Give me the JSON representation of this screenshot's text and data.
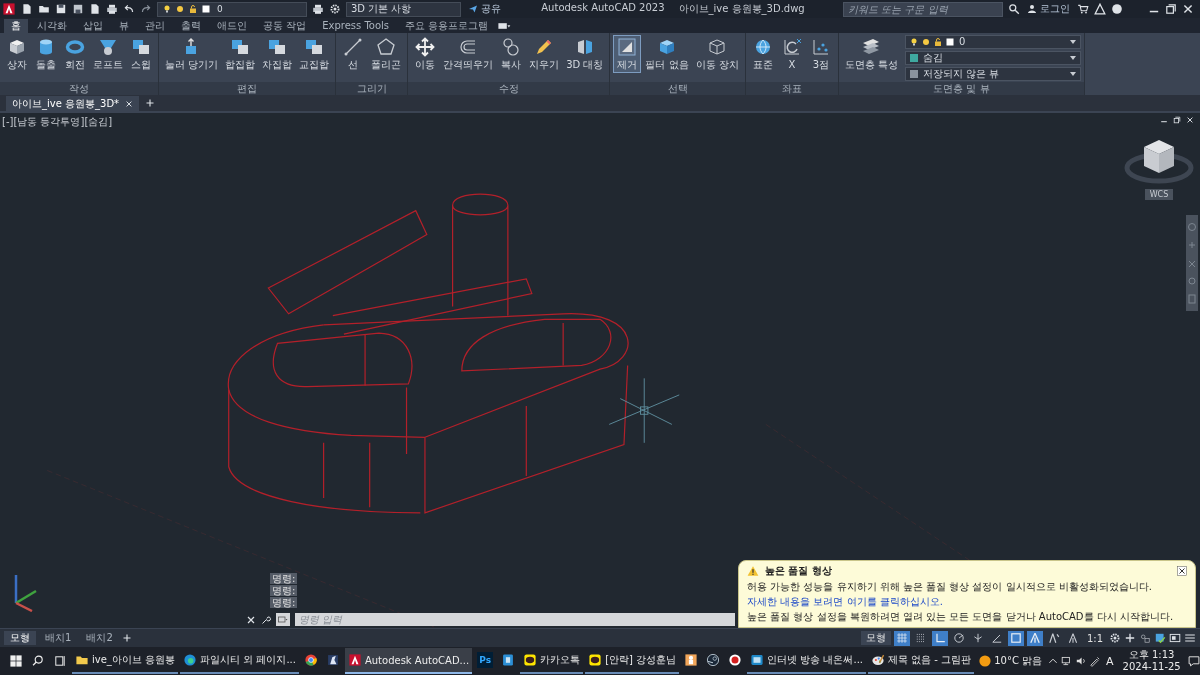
{
  "title_bar": {
    "layer": "0",
    "workspace": "3D 기본 사항",
    "share": "공유",
    "app_name": "Autodesk AutoCAD 2023",
    "file_name": "아이브_ive 응원봉_3D.dwg",
    "search": {
      "placeholder": "키워드 또는 구문 입력"
    },
    "login": "로그인"
  },
  "ribbon_tabs": [
    {
      "label": "홈",
      "selected": true
    },
    {
      "label": "시각화",
      "selected": false
    },
    {
      "label": "삽입",
      "selected": false
    },
    {
      "label": "뷰",
      "selected": false
    },
    {
      "label": "관리",
      "selected": false
    },
    {
      "label": "출력",
      "selected": false
    },
    {
      "label": "애드인",
      "selected": false
    },
    {
      "label": "공동 작업",
      "selected": false
    },
    {
      "label": "Express Tools",
      "selected": false
    },
    {
      "label": "주요 응용프로그램",
      "selected": false
    }
  ],
  "ribbon_panels": [
    {
      "title": "작성",
      "tools": [
        {
          "label": "상자",
          "selected": false
        },
        {
          "label": "돌출",
          "selected": false
        },
        {
          "label": "회전",
          "selected": false
        },
        {
          "label": "로프트",
          "selected": false
        },
        {
          "label": "스윕",
          "selected": false
        }
      ]
    },
    {
      "title": "편집",
      "tools": [
        {
          "label": "눌러 당기기",
          "selected": false
        },
        {
          "label": "합집합",
          "selected": false
        },
        {
          "label": "차집합",
          "selected": false
        },
        {
          "label": "교집합",
          "selected": false
        }
      ]
    },
    {
      "title": "그리기",
      "tools": [
        {
          "label": "선",
          "selected": false
        },
        {
          "label": "폴리곤",
          "selected": false
        }
      ]
    },
    {
      "title": "수정",
      "tools": [
        {
          "label": "이동",
          "selected": false
        },
        {
          "label": "간격띄우기",
          "selected": false
        },
        {
          "label": "복사",
          "selected": false
        },
        {
          "label": "지우기",
          "selected": false
        },
        {
          "label": "3D 대칭",
          "selected": false
        }
      ]
    },
    {
      "title": "선택",
      "tools": [
        {
          "label": "제거",
          "selected": true
        },
        {
          "label": "필터 없음",
          "selected": false
        },
        {
          "label": "이동 장치",
          "selected": false
        }
      ]
    },
    {
      "title": "좌표",
      "tools": [
        {
          "label": "표준",
          "selected": false
        },
        {
          "label": "X",
          "selected": false
        },
        {
          "label": "3점",
          "selected": false
        }
      ]
    },
    {
      "title": "도면층 및 뷰",
      "tools": [
        {
          "label": "도면층 특성",
          "selected": false
        }
      ],
      "dropdowns": [
        {
          "value": "0"
        },
        {
          "value": "숨김"
        },
        {
          "value": "저장되지 않은 뷰"
        }
      ]
    }
  ],
  "doc_tabs": [
    {
      "label": "아이브_ive 응원봉_3D*",
      "selected": true
    }
  ],
  "viewport": {
    "label": "[-][남동 등각투영][숨김]",
    "viewcube_label": "WCS"
  },
  "command_history": [
    "명령:",
    "명령:",
    "명령:"
  ],
  "command_line": {
    "placeholder": "명령 입력"
  },
  "notification": {
    "title": "높은 품질 형상",
    "message": "허용 가능한 성능을 유지하기 위해 높은 품질 형상 설정이 일시적으로 비활성화되었습니다.",
    "link": "자세한 내용을 보려면 여기를 클릭하십시오.",
    "note": "높은 품질 형상 설정을 복원하려면 열려 있는 모든 도면을 닫거나 AutoCAD를 다시 시작합니다."
  },
  "layout_tabs": [
    {
      "label": "모형",
      "selected": true
    },
    {
      "label": "배치1",
      "selected": false
    },
    {
      "label": "배치2",
      "selected": false
    }
  ],
  "status_bar": {
    "mode": "모형",
    "toggles": [
      {
        "on": true
      },
      {
        "on": false
      },
      {
        "on": true
      },
      {
        "on": false
      },
      {
        "on": false
      },
      {
        "on": false
      },
      {
        "on": true
      },
      {
        "on": true
      },
      {
        "on": false
      },
      {
        "on": false
      }
    ],
    "scale": "1:1"
  },
  "taskbar": {
    "apps": [
      {
        "label": "ive_아이브 응원봉",
        "active": false
      },
      {
        "label": "파일시티 외 페이지...",
        "active": false
      },
      {
        "active": false
      },
      {
        "active": false
      },
      {
        "label": "Autodesk AutoCAD...",
        "active": true
      },
      {
        "icon_text": "Ps",
        "active": false
      },
      {
        "active": false
      },
      {
        "label": "카카오톡",
        "active": false
      },
      {
        "label": "[안락] 강성훈님",
        "active": false
      },
      {
        "active": false
      },
      {
        "active": false
      },
      {
        "active": false
      },
      {
        "label": "인터넷 방송 내온써...",
        "active": false
      },
      {
        "label": "제목 없음 - 그림판",
        "active": false
      }
    ],
    "weather": "10°C 맑음",
    "ime": "A",
    "time": "오후 1:13",
    "date": "2024-11-25"
  }
}
